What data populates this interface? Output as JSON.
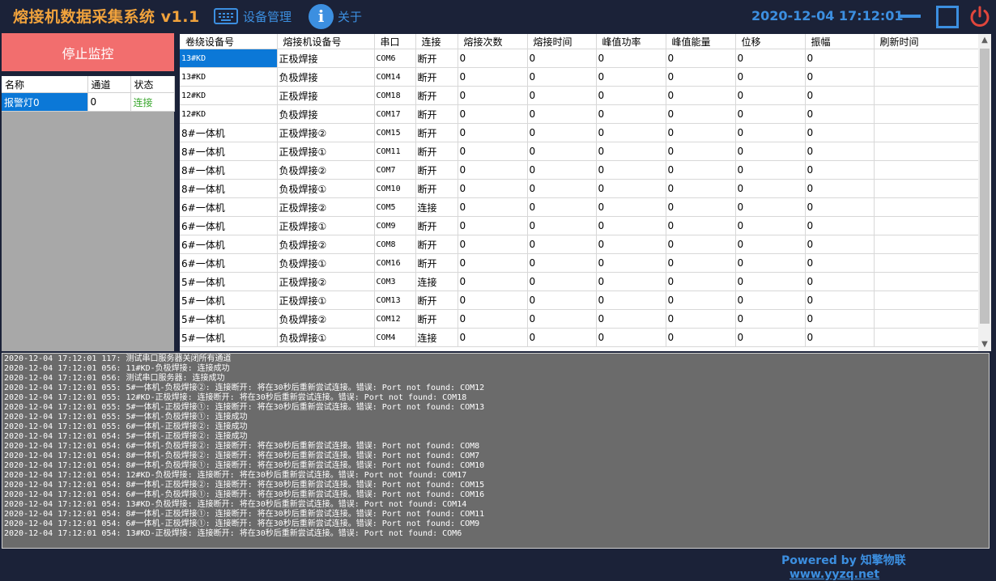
{
  "header": {
    "title": "熔接机数据采集系统 v1.1",
    "nav_device": "设备管理",
    "nav_about": "关于",
    "datetime": "2020-12-04 17:12:01"
  },
  "left": {
    "stop_button": "停止监控",
    "alarm_table": {
      "columns": [
        "名称",
        "通道",
        "状态"
      ],
      "rows": [
        {
          "name": "报警灯0",
          "channel": "0",
          "status": "连接"
        }
      ]
    }
  },
  "device_table": {
    "columns": [
      "卷绕设备号",
      "熔接机设备号",
      "串口",
      "连接",
      "熔接次数",
      "熔接时间",
      "峰值功率",
      "峰值能量",
      "位移",
      "振幅",
      "刷新时间"
    ],
    "rows": [
      {
        "winder": "13#KD",
        "welder": "正极焊接",
        "port": "COM6",
        "conn": "断开",
        "count": "0",
        "time": "0",
        "power": "0",
        "energy": "0",
        "disp": "0",
        "amp": "0",
        "refresh": ""
      },
      {
        "winder": "13#KD",
        "welder": "负极焊接",
        "port": "COM14",
        "conn": "断开",
        "count": "0",
        "time": "0",
        "power": "0",
        "energy": "0",
        "disp": "0",
        "amp": "0",
        "refresh": ""
      },
      {
        "winder": "12#KD",
        "welder": "正极焊接",
        "port": "COM18",
        "conn": "断开",
        "count": "0",
        "time": "0",
        "power": "0",
        "energy": "0",
        "disp": "0",
        "amp": "0",
        "refresh": ""
      },
      {
        "winder": "12#KD",
        "welder": "负极焊接",
        "port": "COM17",
        "conn": "断开",
        "count": "0",
        "time": "0",
        "power": "0",
        "energy": "0",
        "disp": "0",
        "amp": "0",
        "refresh": ""
      },
      {
        "winder": "8#一体机",
        "welder": "正极焊接②",
        "port": "COM15",
        "conn": "断开",
        "count": "0",
        "time": "0",
        "power": "0",
        "energy": "0",
        "disp": "0",
        "amp": "0",
        "refresh": ""
      },
      {
        "winder": "8#一体机",
        "welder": "正极焊接①",
        "port": "COM11",
        "conn": "断开",
        "count": "0",
        "time": "0",
        "power": "0",
        "energy": "0",
        "disp": "0",
        "amp": "0",
        "refresh": ""
      },
      {
        "winder": "8#一体机",
        "welder": "负极焊接②",
        "port": "COM7",
        "conn": "断开",
        "count": "0",
        "time": "0",
        "power": "0",
        "energy": "0",
        "disp": "0",
        "amp": "0",
        "refresh": ""
      },
      {
        "winder": "8#一体机",
        "welder": "负极焊接①",
        "port": "COM10",
        "conn": "断开",
        "count": "0",
        "time": "0",
        "power": "0",
        "energy": "0",
        "disp": "0",
        "amp": "0",
        "refresh": ""
      },
      {
        "winder": "6#一体机",
        "welder": "正极焊接②",
        "port": "COM5",
        "conn": "连接",
        "count": "0",
        "time": "0",
        "power": "0",
        "energy": "0",
        "disp": "0",
        "amp": "0",
        "refresh": ""
      },
      {
        "winder": "6#一体机",
        "welder": "正极焊接①",
        "port": "COM9",
        "conn": "断开",
        "count": "0",
        "time": "0",
        "power": "0",
        "energy": "0",
        "disp": "0",
        "amp": "0",
        "refresh": ""
      },
      {
        "winder": "6#一体机",
        "welder": "负极焊接②",
        "port": "COM8",
        "conn": "断开",
        "count": "0",
        "time": "0",
        "power": "0",
        "energy": "0",
        "disp": "0",
        "amp": "0",
        "refresh": ""
      },
      {
        "winder": "6#一体机",
        "welder": "负极焊接①",
        "port": "COM16",
        "conn": "断开",
        "count": "0",
        "time": "0",
        "power": "0",
        "energy": "0",
        "disp": "0",
        "amp": "0",
        "refresh": ""
      },
      {
        "winder": "5#一体机",
        "welder": "正极焊接②",
        "port": "COM3",
        "conn": "连接",
        "count": "0",
        "time": "0",
        "power": "0",
        "energy": "0",
        "disp": "0",
        "amp": "0",
        "refresh": ""
      },
      {
        "winder": "5#一体机",
        "welder": "正极焊接①",
        "port": "COM13",
        "conn": "断开",
        "count": "0",
        "time": "0",
        "power": "0",
        "energy": "0",
        "disp": "0",
        "amp": "0",
        "refresh": ""
      },
      {
        "winder": "5#一体机",
        "welder": "负极焊接②",
        "port": "COM12",
        "conn": "断开",
        "count": "0",
        "time": "0",
        "power": "0",
        "energy": "0",
        "disp": "0",
        "amp": "0",
        "refresh": ""
      },
      {
        "winder": "5#一体机",
        "welder": "负极焊接①",
        "port": "COM4",
        "conn": "连接",
        "count": "0",
        "time": "0",
        "power": "0",
        "energy": "0",
        "disp": "0",
        "amp": "0",
        "refresh": ""
      }
    ]
  },
  "log": [
    "2020-12-04 17:12:01 117: 测试串口服务器关闭所有通道",
    "2020-12-04 17:12:01 056: 11#KD-负极焊接: 连接成功",
    "2020-12-04 17:12:01 056: 测试串口服务器: 连接成功",
    "2020-12-04 17:12:01 055: 5#一体机-负极焊接②: 连接断开: 将在30秒后重新尝试连接。错误: Port not found: COM12",
    "2020-12-04 17:12:01 055: 12#KD-正极焊接: 连接断开: 将在30秒后重新尝试连接。错误: Port not found: COM18",
    "2020-12-04 17:12:01 055: 5#一体机-正极焊接①: 连接断开: 将在30秒后重新尝试连接。错误: Port not found: COM13",
    "2020-12-04 17:12:01 055: 5#一体机-负极焊接①: 连接成功",
    "2020-12-04 17:12:01 055: 6#一体机-正极焊接②: 连接成功",
    "2020-12-04 17:12:01 054: 5#一体机-正极焊接②: 连接成功",
    "2020-12-04 17:12:01 054: 6#一体机-负极焊接②: 连接断开: 将在30秒后重新尝试连接。错误: Port not found: COM8",
    "2020-12-04 17:12:01 054: 8#一体机-负极焊接②: 连接断开: 将在30秒后重新尝试连接。错误: Port not found: COM7",
    "2020-12-04 17:12:01 054: 8#一体机-负极焊接①: 连接断开: 将在30秒后重新尝试连接。错误: Port not found: COM10",
    "2020-12-04 17:12:01 054: 12#KD-负极焊接: 连接断开: 将在30秒后重新尝试连接。错误: Port not found: COM17",
    "2020-12-04 17:12:01 054: 8#一体机-正极焊接②: 连接断开: 将在30秒后重新尝试连接。错误: Port not found: COM15",
    "2020-12-04 17:12:01 054: 6#一体机-负极焊接①: 连接断开: 将在30秒后重新尝试连接。错误: Port not found: COM16",
    "2020-12-04 17:12:01 054: 13#KD-负极焊接: 连接断开: 将在30秒后重新尝试连接。错误: Port not found: COM14",
    "2020-12-04 17:12:01 054: 8#一体机-正极焊接①: 连接断开: 将在30秒后重新尝试连接。错误: Port not found: COM11",
    "2020-12-04 17:12:01 054: 6#一体机-正极焊接①: 连接断开: 将在30秒后重新尝试连接。错误: Port not found: COM9",
    "2020-12-04 17:12:01 054: 13#KD-正极焊接: 连接断开: 将在30秒后重新尝试连接。错误: Port not found: COM6"
  ],
  "footer": {
    "powered": "Powered by 知擎物联",
    "link": "www.yyzq.net"
  },
  "colors": {
    "background": "#1b2238",
    "title": "#f0a23c",
    "accent": "#3c8fe0",
    "stop_button": "#f26e6e",
    "status_connected": "#3aa72f",
    "status_disconnected": "#e0463c",
    "selected_cell": "#0b78d7",
    "log_background": "#6b6b6b"
  },
  "icons": {
    "device_manage": "keyboard-icon",
    "about": "info-icon",
    "minimize": "minimize-icon",
    "maximize": "maximize-icon",
    "close": "power-icon"
  }
}
